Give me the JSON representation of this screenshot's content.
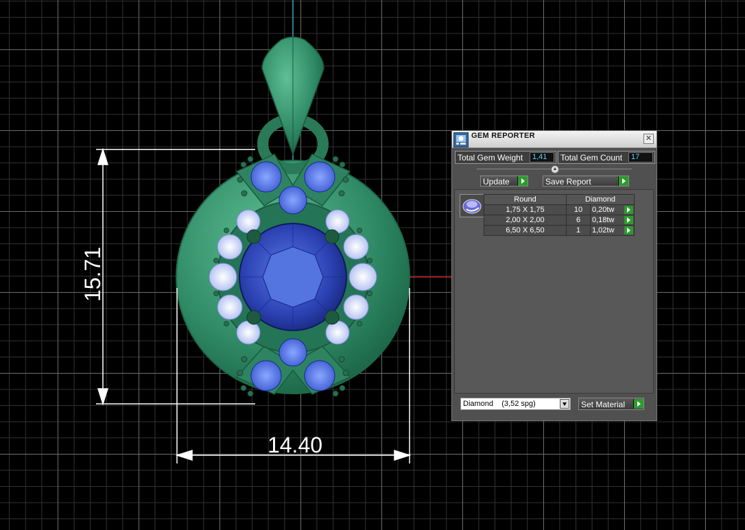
{
  "viewport": {
    "dimension_width": "14.40",
    "dimension_height": "15.71"
  },
  "colors": {
    "metal": "#2f8a65",
    "center_stone": "#2a40b0",
    "melee_stone": "#4a6ee0",
    "halo_stone": "#c8d4ff",
    "dimension_lines": "#ffffff",
    "accent_value": "#5fd0ff",
    "go_button": "#2e9a2e"
  },
  "panel": {
    "title": "GEM REPORTER",
    "close_icon": "close-icon",
    "total_weight_label": "Total Gem Weight",
    "total_weight_value": "1,41",
    "total_count_label": "Total Gem Count",
    "total_count_value": "17",
    "update_label": "Update",
    "save_report_label": "Save Report",
    "table": {
      "shape_header": "Round",
      "material_header": "Diamond",
      "rows": [
        {
          "size": "1,75 X 1,75",
          "count": "10",
          "weight": "0,20tw"
        },
        {
          "size": "2,00 X 2,00",
          "count": "6",
          "weight": "0,18tw"
        },
        {
          "size": "6,50 X 6,50",
          "count": "1",
          "weight": "1,02tw"
        }
      ]
    },
    "material_select_value": "Diamond    (3,52 spg)",
    "set_material_label": "Set Material"
  }
}
